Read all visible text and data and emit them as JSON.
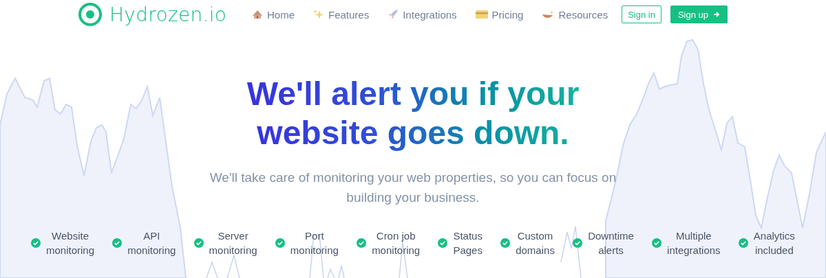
{
  "brand": {
    "name": "Hydrozen.io"
  },
  "nav": [
    {
      "label": "Home"
    },
    {
      "label": "Features"
    },
    {
      "label": "Integrations"
    },
    {
      "label": "Pricing"
    },
    {
      "label": "Resources"
    }
  ],
  "actions": [
    {
      "label": "Sign in",
      "kind": "outline"
    },
    {
      "label": "Sign up",
      "kind": "filled"
    }
  ],
  "hero": {
    "title": "We'll alert you if your website goes down.",
    "subtitle": "We'll take care of monitoring your web properties, so you can focus on building your business."
  },
  "features": [
    {
      "label": "Website\nmonitoring"
    },
    {
      "label": "API\nmonitoring"
    },
    {
      "label": "Server\nmonitoring"
    },
    {
      "label": "Port\nmonitoring"
    },
    {
      "label": "Cron job\nmonitoring"
    },
    {
      "label": "Status\nPages"
    },
    {
      "label": "Custom\ndomains"
    },
    {
      "label": "Downtime\nalerts"
    },
    {
      "label": "Multiple\nintegrations"
    },
    {
      "label": "Analytics\nincluded"
    }
  ]
}
